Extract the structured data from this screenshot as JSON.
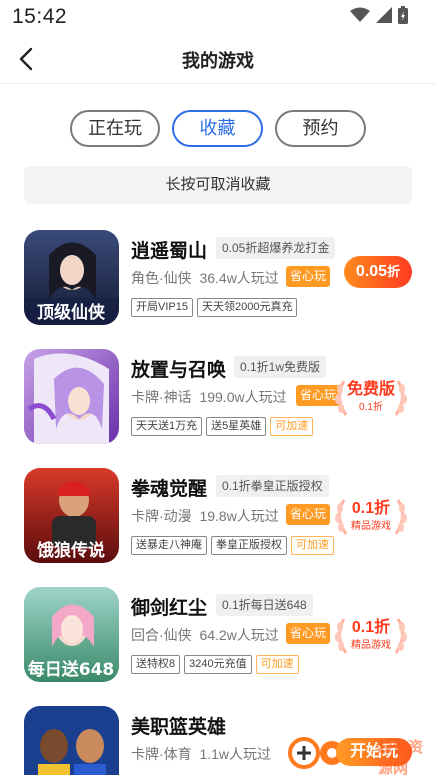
{
  "status_bar": {
    "time": "15:42",
    "icons": [
      "wifi-icon",
      "signal-icon",
      "battery-icon"
    ]
  },
  "header": {
    "title": "我的游戏",
    "back_icon": "chevron-left-icon"
  },
  "tabs": [
    {
      "label": "正在玩",
      "selected": false
    },
    {
      "label": "收藏",
      "selected": true
    },
    {
      "label": "预约",
      "selected": false
    }
  ],
  "hint": "长按可取消收藏",
  "games": [
    {
      "name": "逍遥蜀山",
      "promo": "0.05折超爆养龙打金",
      "category": "角色·仙侠",
      "players": "36.4w人玩过",
      "save_badge": "省心玩",
      "tags": [
        "开局VIP15",
        "天天领2000元真充"
      ],
      "action": {
        "type": "price",
        "value": "0.05",
        "unit": "折"
      }
    },
    {
      "name": "放置与召唤",
      "promo": "0.1折1w免费版",
      "category": "卡牌·神话",
      "players": "199.0w人玩过",
      "save_badge": "省心玩",
      "tags": [
        "天天送1万充",
        "送5星英雄",
        "可加速"
      ],
      "action": {
        "type": "wreath",
        "main": "免费版",
        "sub": "0.1折"
      }
    },
    {
      "name": "拳魂觉醒",
      "promo": "0.1折拳皇正版授权",
      "category": "卡牌·动漫",
      "players": "19.8w人玩过",
      "save_badge": "省心玩",
      "tags": [
        "送暴走八神庵",
        "拳皇正版授权",
        "可加速"
      ],
      "action": {
        "type": "wreath",
        "main": "0.1折",
        "sub": "精品游戏"
      }
    },
    {
      "name": "御剑红尘",
      "promo": "0.1折每日送648",
      "category": "回合·仙侠",
      "players": "64.2w人玩过",
      "save_badge": "省心玩",
      "tags": [
        "送特权8",
        "3240元充值",
        "可加速"
      ],
      "action": {
        "type": "wreath",
        "main": "0.1折",
        "sub": "精品游戏"
      }
    },
    {
      "name": "美职篮英雄",
      "promo": "",
      "category": "卡牌·体育",
      "players": "1.1w人玩过",
      "save_badge": "",
      "tags": [],
      "action": {
        "type": "none"
      }
    }
  ],
  "start_button": "开始玩",
  "watermark": "绿色资源网"
}
